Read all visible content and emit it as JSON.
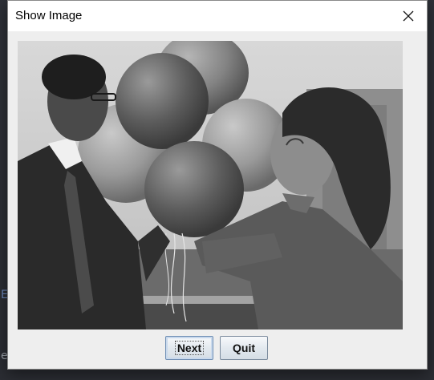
{
  "window": {
    "title": "Show Image",
    "close_icon": "close-icon"
  },
  "image": {
    "subject": "grayscale photograph",
    "icon": "photo"
  },
  "buttons": {
    "next_label": "Next",
    "quit_label": "Quit"
  },
  "background": {
    "left_glyph_1": "E",
    "left_glyph_2": "e"
  },
  "colors": {
    "client_bg": "#eeeeee",
    "title_bg": "#ffffff",
    "button_border": "#7a8a9c"
  }
}
